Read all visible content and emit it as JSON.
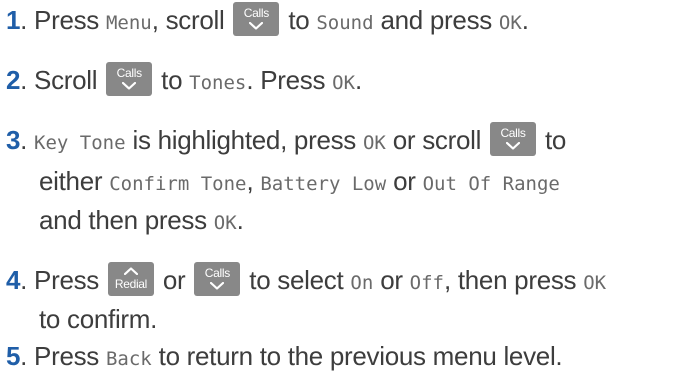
{
  "colors": {
    "step_number": "#1f5ea8",
    "text": "#3d3d3d",
    "display_text": "#6a6a6a",
    "key_bg": "#888888"
  },
  "keys": {
    "calls": "Calls",
    "redial": "Redial"
  },
  "icons": {
    "calls_key": "chevron-down-icon",
    "redial_key": "chevron-up-icon"
  },
  "steps": [
    {
      "number": "1",
      "press": "Press",
      "menu": "Menu",
      "scroll": ", scroll",
      "to": "to",
      "sound": "Sound",
      "and_press": "and press",
      "ok": "OK",
      "end": "."
    },
    {
      "number": "2",
      "scroll": "Scroll",
      "to": "to",
      "tones": "Tones",
      "press": ". Press",
      "ok": "OK",
      "end": "."
    },
    {
      "number": "3",
      "key_tone": "Key Tone",
      "highlighted": "is highlighted, press",
      "ok": "OK",
      "or_scroll": "or scroll",
      "to": "to",
      "either": "either",
      "confirm_tone": "Confirm Tone",
      "comma": ",",
      "battery_low": "Battery Low",
      "or": "or",
      "out_of_range": "Out Of Range",
      "and_press": "and then press",
      "ok2": "OK",
      "end": "."
    },
    {
      "number": "4",
      "press": "Press",
      "or": "or",
      "to_select": "to select",
      "on": "On",
      "or2": "or",
      "off": "Off",
      "then_press": ", then press",
      "ok": "OK",
      "confirm": "to confirm."
    },
    {
      "number": "5",
      "press": "Press",
      "back": "Back",
      "rest": "to return to the previous menu level."
    }
  ]
}
